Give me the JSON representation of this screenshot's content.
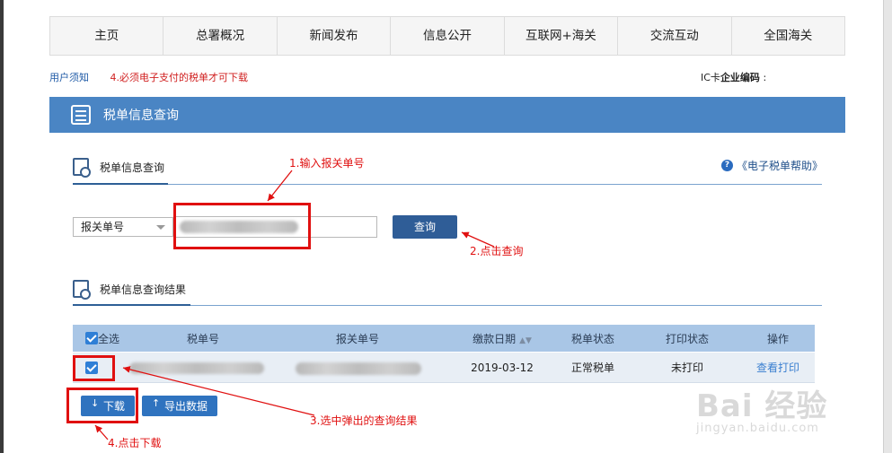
{
  "nav": {
    "items": [
      "主页",
      "总署概况",
      "新闻发布",
      "信息公开",
      "互联网+海关",
      "交流互动",
      "全国海关"
    ]
  },
  "notice": {
    "user_link": "用户须知",
    "warning": "4.必须电子支付的税单才可下载"
  },
  "iccard": {
    "prefix": "IC卡",
    "label": "企业编码",
    "suffix": ":"
  },
  "panel": {
    "title": "税单信息查询"
  },
  "search_section": {
    "title": "税单信息查询",
    "help_link": "《电子税单帮助》"
  },
  "search": {
    "select_value": "报关单号",
    "button_label": "查询"
  },
  "result_section": {
    "title": "税单信息查询结果"
  },
  "table": {
    "headers": {
      "select_all": "全选",
      "tax_no": "税单号",
      "declaration_no": "报关单号",
      "pay_date": "缴款日期",
      "tax_status": "税单状态",
      "print_status": "打印状态",
      "action": "操作"
    },
    "rows": [
      {
        "pay_date": "2019-03-12",
        "tax_status": "正常税单",
        "print_status": "未打印",
        "action": "查看打印"
      }
    ]
  },
  "buttons": {
    "download": "下载",
    "export": "导出数据"
  },
  "annotations": {
    "a1": "1.输入报关单号",
    "a2": "2.点击查询",
    "a3": "3.选中弹出的查询结果",
    "a4": "4.点击下载"
  },
  "watermark": {
    "main": "Bai 经验",
    "sub": "jingyan.baidu.com"
  },
  "colors": {
    "header_blue": "#4a85c4",
    "button_blue": "#2f5d97",
    "annotation_red": "#e01010"
  }
}
